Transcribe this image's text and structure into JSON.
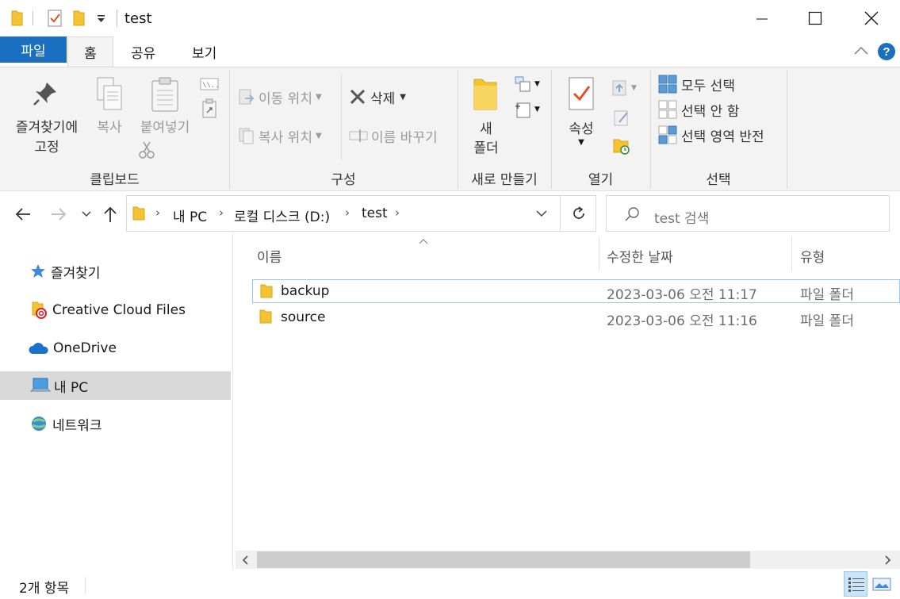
{
  "window": {
    "title": "test"
  },
  "tabs": {
    "file": "파일",
    "home": "홈",
    "share": "공유",
    "view": "보기"
  },
  "ribbon": {
    "clipboard": {
      "pin_line1": "즐겨찾기에",
      "pin_line2": "고정",
      "copy": "복사",
      "paste": "붙여넣기",
      "group": "클립보드"
    },
    "organize": {
      "move_to": "이동 위치",
      "copy_to": "복사 위치",
      "delete": "삭제",
      "rename": "이름 바꾸기",
      "group": "구성"
    },
    "new": {
      "folder_line1": "새",
      "folder_line2": "폴더",
      "group": "새로 만들기"
    },
    "open": {
      "properties": "속성",
      "group": "열기"
    },
    "select": {
      "select_all": "모두 선택",
      "select_none": "선택 안 함",
      "invert": "선택 영역 반전",
      "group": "선택"
    }
  },
  "address": {
    "crumbs": [
      "내 PC",
      "로컬 디스크 (D:)",
      "test"
    ]
  },
  "search": {
    "placeholder": "test 검색"
  },
  "nav": {
    "items": [
      "즐겨찾기",
      "Creative Cloud Files",
      "OneDrive",
      "내 PC",
      "네트워크"
    ],
    "selected": "내 PC"
  },
  "columns": {
    "name": "이름",
    "modified": "수정한 날짜",
    "type": "유형"
  },
  "files": [
    {
      "name": "backup",
      "modified": "2023-03-06 오전 11:17",
      "type": "파일 폴더"
    },
    {
      "name": "source",
      "modified": "2023-03-06 오전 11:16",
      "type": "파일 폴더"
    }
  ],
  "status": {
    "count": "2개 항목"
  },
  "colors": {
    "accent": "#1a6fc0",
    "folder": "#f4c430",
    "selection": "#cce4f7",
    "nav_selected": "#d9d9d9"
  }
}
